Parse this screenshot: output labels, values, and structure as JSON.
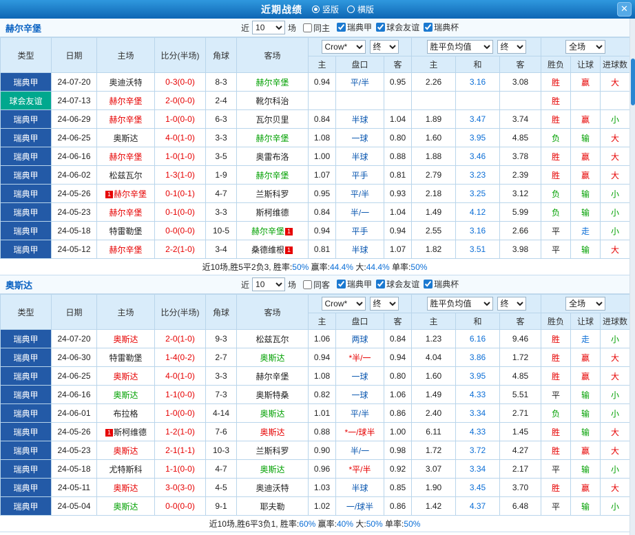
{
  "titlebar": {
    "title": "近期战绩",
    "radios": [
      {
        "label": "竖版",
        "selected": true
      },
      {
        "label": "横版",
        "selected": false
      }
    ],
    "close": "✕"
  },
  "colors": {
    "accent_red": "#e60000",
    "accent_green": "#00a000",
    "accent_blue": "#0b6ed6",
    "handicap_blue": "#0a57b0",
    "league_blue": "#235aa7",
    "friendly_teal": "#00a88e",
    "header_bg": "#d9ecfa",
    "titlebar_blue": "#1473c4"
  },
  "maps": {
    "league_styles": {
      "瑞典甲": "blue",
      "球会友谊": "teal"
    },
    "flag_colors": {
      "胜": "r",
      "负": "g",
      "平": "k",
      "赢": "r",
      "输": "g",
      "走": "b",
      "大": "r",
      "小": "g"
    }
  },
  "table_header": {
    "type": "类型",
    "date": "日期",
    "home": "主场",
    "score": "比分(半场)",
    "corner": "角球",
    "away": "客场",
    "bookmaker_select": "Crow*",
    "odds_final_select": "终",
    "avg_select": "胜平负均值",
    "avg_final_select": "终",
    "scope_select": "全场",
    "sub": [
      "主",
      "盘口",
      "客",
      "主",
      "和",
      "客",
      "胜负",
      "让球",
      "进球数"
    ]
  },
  "sections": [
    {
      "team": "赫尔辛堡",
      "filters": {
        "near": "近",
        "count": "10",
        "games": "场",
        "same": {
          "label": "同主",
          "checked": false
        },
        "comps": [
          {
            "label": "瑞典甲",
            "checked": true
          },
          {
            "label": "球会友谊",
            "checked": true
          },
          {
            "label": "瑞典杯",
            "checked": true
          }
        ]
      },
      "rows": [
        {
          "league": "瑞典甲",
          "date": "24-07-20",
          "home": {
            "t": "奥迪沃特"
          },
          "score": "0-3(0-0)",
          "corner": "8-3",
          "away": {
            "t": "赫尔辛堡",
            "c": "g"
          },
          "odds": [
            "0.94",
            "平/半",
            "0.95"
          ],
          "avg": [
            "2.26",
            "3.16",
            "3.08"
          ],
          "flags": [
            "胜",
            "赢",
            "大"
          ]
        },
        {
          "league": "球会友谊",
          "date": "24-07-13",
          "home": {
            "t": "赫尔辛堡",
            "c": "r"
          },
          "score": "2-0(0-0)",
          "corner": "2-4",
          "away": {
            "t": "靴尔科治"
          },
          "odds": [
            "",
            "",
            ""
          ],
          "avg": [
            "",
            "",
            ""
          ],
          "flags": [
            "胜",
            "",
            ""
          ]
        },
        {
          "league": "瑞典甲",
          "date": "24-06-29",
          "home": {
            "t": "赫尔辛堡",
            "c": "r"
          },
          "score": "1-0(0-0)",
          "corner": "6-3",
          "away": {
            "t": "瓦尔贝里"
          },
          "odds": [
            "0.84",
            "半球",
            "1.04"
          ],
          "avg": [
            "1.89",
            "3.47",
            "3.74"
          ],
          "flags": [
            "胜",
            "赢",
            "小"
          ]
        },
        {
          "league": "瑞典甲",
          "date": "24-06-25",
          "home": {
            "t": "奥斯达"
          },
          "score": "4-0(1-0)",
          "corner": "3-3",
          "away": {
            "t": "赫尔辛堡",
            "c": "g"
          },
          "odds": [
            "1.08",
            "一球",
            "0.80"
          ],
          "avg": [
            "1.60",
            "3.95",
            "4.85"
          ],
          "flags": [
            "负",
            "输",
            "大"
          ]
        },
        {
          "league": "瑞典甲",
          "date": "24-06-16",
          "home": {
            "t": "赫尔辛堡",
            "c": "r"
          },
          "score": "1-0(1-0)",
          "corner": "3-5",
          "away": {
            "t": "奥雷布洛"
          },
          "odds": [
            "1.00",
            "半球",
            "0.88"
          ],
          "avg": [
            "1.88",
            "3.46",
            "3.78"
          ],
          "flags": [
            "胜",
            "赢",
            "大"
          ]
        },
        {
          "league": "瑞典甲",
          "date": "24-06-02",
          "home": {
            "t": "松兹瓦尔"
          },
          "score": "1-3(1-0)",
          "corner": "1-9",
          "away": {
            "t": "赫尔辛堡",
            "c": "g"
          },
          "odds": [
            "1.07",
            "平手",
            "0.81"
          ],
          "avg": [
            "2.79",
            "3.23",
            "2.39"
          ],
          "flags": [
            "胜",
            "赢",
            "大"
          ]
        },
        {
          "league": "瑞典甲",
          "date": "24-05-26",
          "home": {
            "t": "赫尔辛堡",
            "c": "r",
            "badge": "1",
            "bp": "before"
          },
          "score": "0-1(0-1)",
          "corner": "4-7",
          "away": {
            "t": "兰斯科罗"
          },
          "odds": [
            "0.95",
            "平/半",
            "0.93"
          ],
          "avg": [
            "2.18",
            "3.25",
            "3.12"
          ],
          "flags": [
            "负",
            "输",
            "小"
          ]
        },
        {
          "league": "瑞典甲",
          "date": "24-05-23",
          "home": {
            "t": "赫尔辛堡",
            "c": "r"
          },
          "score": "0-1(0-0)",
          "corner": "3-3",
          "away": {
            "t": "斯柯维德"
          },
          "odds": [
            "0.84",
            "半/一",
            "1.04"
          ],
          "avg": [
            "1.49",
            "4.12",
            "5.99"
          ],
          "flags": [
            "负",
            "输",
            "小"
          ]
        },
        {
          "league": "瑞典甲",
          "date": "24-05-18",
          "home": {
            "t": "特雷勒堡"
          },
          "score": "0-0(0-0)",
          "corner": "10-5",
          "away": {
            "t": "赫尔辛堡",
            "c": "g",
            "badge": "1",
            "bp": "after"
          },
          "odds": [
            "0.94",
            "平手",
            "0.94"
          ],
          "avg": [
            "2.55",
            "3.16",
            "2.66"
          ],
          "flags": [
            "平",
            "走",
            "小"
          ]
        },
        {
          "league": "瑞典甲",
          "date": "24-05-12",
          "home": {
            "t": "赫尔辛堡",
            "c": "r"
          },
          "score": "2-2(1-0)",
          "corner": "3-4",
          "away": {
            "t": "桑德维根",
            "badge": "1",
            "bp": "after"
          },
          "odds": [
            "0.81",
            "半球",
            "1.07"
          ],
          "avg": [
            "1.82",
            "3.51",
            "3.98"
          ],
          "flags": [
            "平",
            "输",
            "大"
          ]
        }
      ],
      "summary": [
        {
          "t": "近10场,胜5平2负3, 胜率:",
          "c": "k"
        },
        {
          "t": "50%",
          "c": "b"
        },
        {
          "t": " 赢率:",
          "c": "k"
        },
        {
          "t": "44.4%",
          "c": "b"
        },
        {
          "t": " 大:",
          "c": "k"
        },
        {
          "t": "44.4%",
          "c": "b"
        },
        {
          "t": " 单率:",
          "c": "k"
        },
        {
          "t": "50%",
          "c": "b"
        }
      ]
    },
    {
      "team": "奥斯达",
      "filters": {
        "near": "近",
        "count": "10",
        "games": "场",
        "same": {
          "label": "同客",
          "checked": false
        },
        "comps": [
          {
            "label": "瑞典甲",
            "checked": true
          },
          {
            "label": "球会友谊",
            "checked": true
          },
          {
            "label": "瑞典杯",
            "checked": true
          }
        ]
      },
      "rows": [
        {
          "league": "瑞典甲",
          "date": "24-07-20",
          "home": {
            "t": "奥斯达",
            "c": "r"
          },
          "score": "2-0(1-0)",
          "corner": "9-3",
          "away": {
            "t": "松兹瓦尔"
          },
          "odds": [
            "1.06",
            "两球",
            "0.84"
          ],
          "avg": [
            "1.23",
            "6.16",
            "9.46"
          ],
          "flags": [
            "胜",
            "走",
            "小"
          ]
        },
        {
          "league": "瑞典甲",
          "date": "24-06-30",
          "home": {
            "t": "特雷勒堡"
          },
          "score": "1-4(0-2)",
          "corner": "2-7",
          "away": {
            "t": "奥斯达",
            "c": "g"
          },
          "odds": [
            "0.94",
            "*半/一",
            "0.94"
          ],
          "avg": [
            "4.04",
            "3.86",
            "1.72"
          ],
          "flags": [
            "胜",
            "赢",
            "大"
          ]
        },
        {
          "league": "瑞典甲",
          "date": "24-06-25",
          "home": {
            "t": "奥斯达",
            "c": "r"
          },
          "score": "4-0(1-0)",
          "corner": "3-3",
          "away": {
            "t": "赫尔辛堡"
          },
          "odds": [
            "1.08",
            "一球",
            "0.80"
          ],
          "avg": [
            "1.60",
            "3.95",
            "4.85"
          ],
          "flags": [
            "胜",
            "赢",
            "大"
          ]
        },
        {
          "league": "瑞典甲",
          "date": "24-06-16",
          "home": {
            "t": "奥斯达",
            "c": "g"
          },
          "score": "1-1(0-0)",
          "corner": "7-3",
          "away": {
            "t": "奥斯特桑"
          },
          "odds": [
            "0.82",
            "一球",
            "1.06"
          ],
          "avg": [
            "1.49",
            "4.33",
            "5.51"
          ],
          "flags": [
            "平",
            "输",
            "小"
          ]
        },
        {
          "league": "瑞典甲",
          "date": "24-06-01",
          "home": {
            "t": "布拉格"
          },
          "score": "1-0(0-0)",
          "corner": "4-14",
          "away": {
            "t": "奥斯达",
            "c": "g"
          },
          "odds": [
            "1.01",
            "平/半",
            "0.86"
          ],
          "avg": [
            "2.40",
            "3.34",
            "2.71"
          ],
          "flags": [
            "负",
            "输",
            "小"
          ]
        },
        {
          "league": "瑞典甲",
          "date": "24-05-26",
          "home": {
            "t": "斯柯维德",
            "badge": "1",
            "bp": "before"
          },
          "score": "1-2(1-0)",
          "corner": "7-6",
          "away": {
            "t": "奥斯达",
            "c": "r"
          },
          "odds": [
            "0.88",
            "*一/球半",
            "1.00"
          ],
          "avg": [
            "6.11",
            "4.33",
            "1.45"
          ],
          "flags": [
            "胜",
            "输",
            "大"
          ]
        },
        {
          "league": "瑞典甲",
          "date": "24-05-23",
          "home": {
            "t": "奥斯达",
            "c": "r"
          },
          "score": "2-1(1-1)",
          "corner": "10-3",
          "away": {
            "t": "兰斯科罗"
          },
          "odds": [
            "0.90",
            "半/一",
            "0.98"
          ],
          "avg": [
            "1.72",
            "3.72",
            "4.27"
          ],
          "flags": [
            "胜",
            "赢",
            "大"
          ]
        },
        {
          "league": "瑞典甲",
          "date": "24-05-18",
          "home": {
            "t": "尤特斯科"
          },
          "score": "1-1(0-0)",
          "corner": "4-7",
          "away": {
            "t": "奥斯达",
            "c": "g"
          },
          "odds": [
            "0.96",
            "*平/半",
            "0.92"
          ],
          "avg": [
            "3.07",
            "3.34",
            "2.17"
          ],
          "flags": [
            "平",
            "输",
            "小"
          ]
        },
        {
          "league": "瑞典甲",
          "date": "24-05-11",
          "home": {
            "t": "奥斯达",
            "c": "r"
          },
          "score": "3-0(3-0)",
          "corner": "4-5",
          "away": {
            "t": "奥迪沃特"
          },
          "odds": [
            "1.03",
            "半球",
            "0.85"
          ],
          "avg": [
            "1.90",
            "3.45",
            "3.70"
          ],
          "flags": [
            "胜",
            "赢",
            "大"
          ]
        },
        {
          "league": "瑞典甲",
          "date": "24-05-04",
          "home": {
            "t": "奥斯达",
            "c": "g"
          },
          "score": "0-0(0-0)",
          "corner": "9-1",
          "away": {
            "t": "耶夫勒"
          },
          "odds": [
            "1.02",
            "一/球半",
            "0.86"
          ],
          "avg": [
            "1.42",
            "4.37",
            "6.48"
          ],
          "flags": [
            "平",
            "输",
            "小"
          ]
        }
      ],
      "summary": [
        {
          "t": "近10场,胜6平3负1, 胜率:",
          "c": "k"
        },
        {
          "t": "60%",
          "c": "b"
        },
        {
          "t": " 赢率:",
          "c": "k"
        },
        {
          "t": "40%",
          "c": "b"
        },
        {
          "t": " 大:",
          "c": "k"
        },
        {
          "t": "50%",
          "c": "b"
        },
        {
          "t": " 单率:",
          "c": "k"
        },
        {
          "t": "50%",
          "c": "b"
        }
      ]
    }
  ]
}
